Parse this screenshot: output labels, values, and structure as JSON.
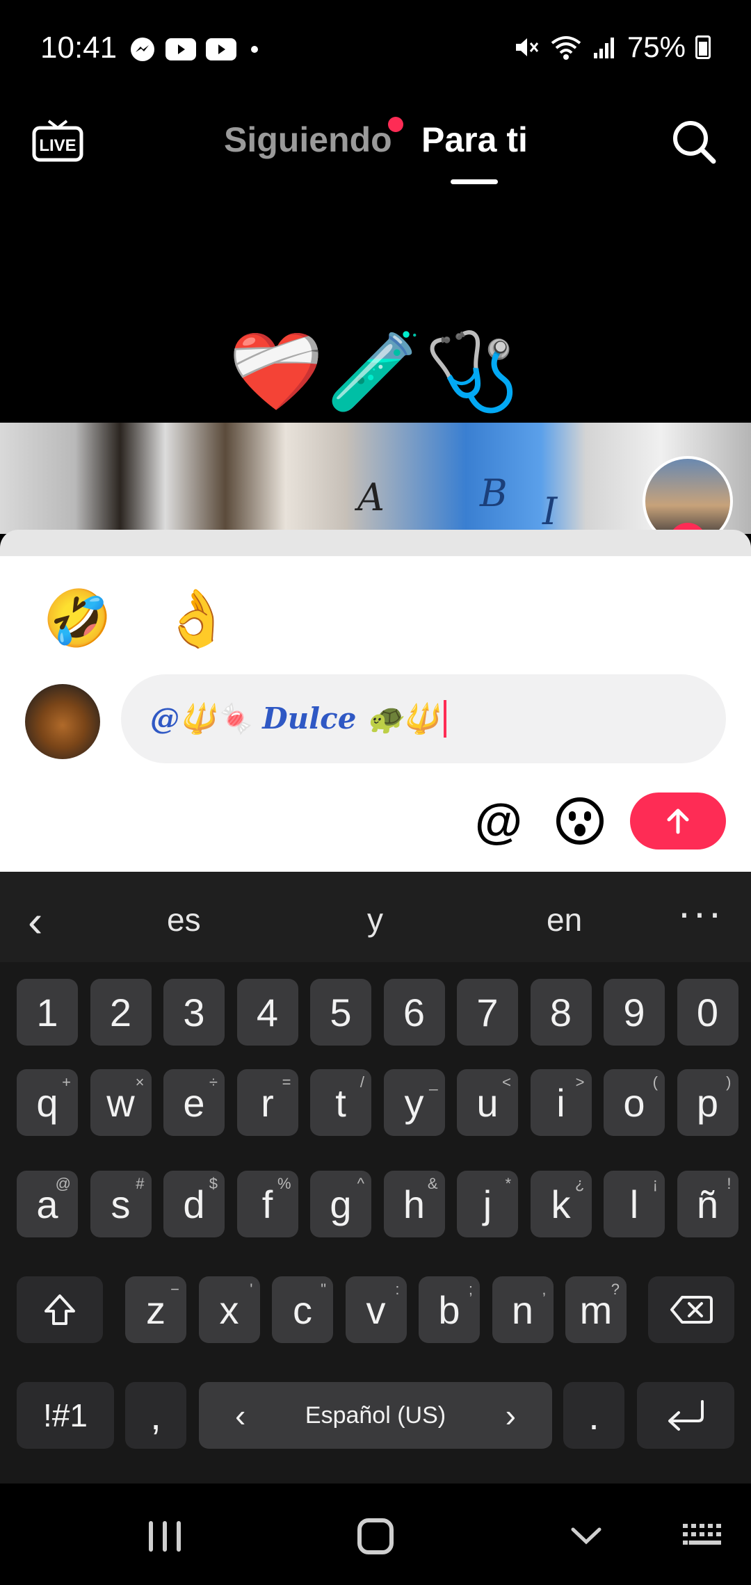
{
  "status_bar": {
    "time": "10:41",
    "battery": "75%",
    "app_icons": [
      "messenger-icon",
      "youtube-icon",
      "youtube-icon",
      "dot"
    ],
    "status_icons": [
      "mute-icon",
      "wifi-icon",
      "signal-icon",
      "battery-icon"
    ]
  },
  "top_nav": {
    "live_label": "LIVE",
    "tab_following": "Siguiendo",
    "tab_for_you": "Para ti",
    "active_tab": "Para ti"
  },
  "video": {
    "overlay_emoji": "❤️‍🩹🧪🩺",
    "hand_letters": [
      "A",
      "B",
      "I"
    ]
  },
  "comment_sheet": {
    "quick_emojis": [
      "🤣",
      "👌",
      "😅",
      "😜",
      "😊",
      "😔"
    ],
    "input_value": "@🔱🍬 Dulce 🐢🔱",
    "mention_button": "@"
  },
  "keyboard": {
    "suggestions": [
      "es",
      "y",
      "en"
    ],
    "number_row": [
      "1",
      "2",
      "3",
      "4",
      "5",
      "6",
      "7",
      "8",
      "9",
      "0"
    ],
    "row1": [
      [
        "q",
        "+"
      ],
      [
        "w",
        "×"
      ],
      [
        "e",
        "÷"
      ],
      [
        "r",
        "="
      ],
      [
        "t",
        "/"
      ],
      [
        "y",
        "_"
      ],
      [
        "u",
        "<"
      ],
      [
        "i",
        ">"
      ],
      [
        "o",
        "("
      ],
      [
        "p",
        ")"
      ]
    ],
    "row2": [
      [
        "a",
        "@"
      ],
      [
        "s",
        "#"
      ],
      [
        "d",
        "$"
      ],
      [
        "f",
        "%"
      ],
      [
        "g",
        "^"
      ],
      [
        "h",
        "&"
      ],
      [
        "j",
        "*"
      ],
      [
        "k",
        "¿"
      ],
      [
        "l",
        "¡"
      ],
      [
        "ñ",
        "!"
      ]
    ],
    "row3": [
      [
        "z",
        "−"
      ],
      [
        "x",
        "'"
      ],
      [
        "c",
        "\""
      ],
      [
        "v",
        ":"
      ],
      [
        "b",
        ";"
      ],
      [
        "n",
        ","
      ],
      [
        "m",
        "?"
      ]
    ],
    "symbols_key": "!#1",
    "comma_key": ",",
    "space_label": "Español (US)",
    "period_key": "."
  },
  "colors": {
    "accent": "#fe2c55",
    "mention_text": "#2f58c4",
    "keyboard_bg": "#181818",
    "key_bg": "#3a3a3c"
  }
}
